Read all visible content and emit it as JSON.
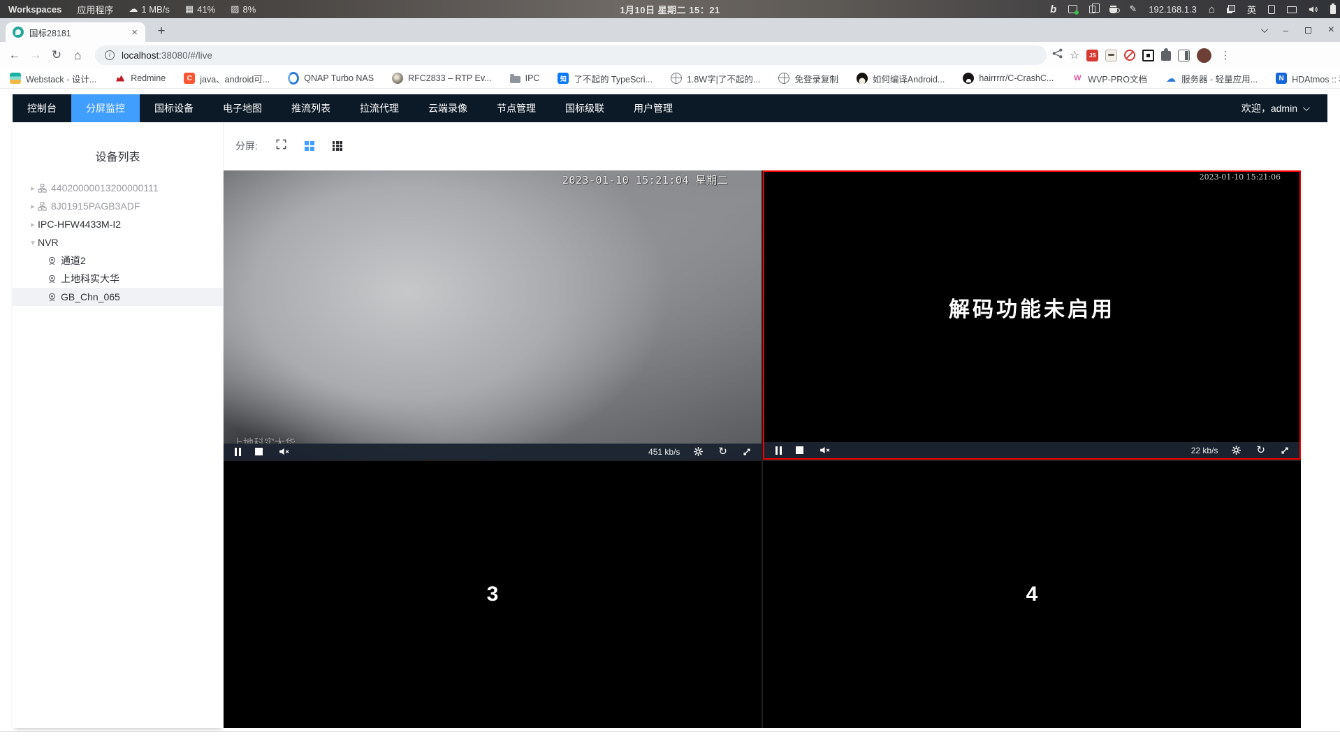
{
  "colors": {
    "accent_blue": "#409eff",
    "nav_bg": "#0c1a27",
    "selected_border_red": "#f30000",
    "favicon_teal": "#23a69a"
  },
  "system_bar": {
    "workspaces": "Workspaces",
    "applications": "应用程序",
    "net_speed": "1 MB/s",
    "cpu_pct": "41%",
    "mem_pct": "8%",
    "clock": "1月10日 星期二 15：21",
    "ip": "192.168.1.3",
    "ime": "英"
  },
  "browser": {
    "tab_title": "国标28181",
    "address": {
      "host": "localhost",
      "rest": ":38080/#/live"
    },
    "bookmarks": [
      {
        "label": "Webstack - 设计..."
      },
      {
        "label": "Redmine"
      },
      {
        "label": "java、android可..."
      },
      {
        "label": "QNAP Turbo NAS"
      },
      {
        "label": "RFC2833 – RTP Ev..."
      },
      {
        "label": "IPC"
      },
      {
        "label": "了不起的 TypeScri..."
      },
      {
        "label": "1.8W字|了不起的..."
      },
      {
        "label": "免登录复制"
      },
      {
        "label": "如何编译Android..."
      },
      {
        "label": "hairrrrr/C-CrashC..."
      },
      {
        "label": "WVP-PRO文档"
      },
      {
        "label": "服务器 - 轻量应用..."
      },
      {
        "label": "HDAtmos :: 种子 *..."
      }
    ],
    "ext_js_label": "JS"
  },
  "glyphs": {
    "back": "←",
    "forward": "→",
    "reload": "↻",
    "home": "⌂",
    "star": "☆",
    "kebab": "⋮",
    "tab_close": "×",
    "new_tab": "+",
    "overflow": "»",
    "minimize": "–",
    "win_close": "×",
    "caret_right": "▸",
    "caret_down": "▾",
    "info": "i",
    "tray_download": "☁",
    "tray_arrow": "↓",
    "tray_cpu": "▦",
    "tray_mem": "▨",
    "tray_pen": "✎",
    "tray_bing": "b"
  },
  "nav": {
    "items": [
      "控制台",
      "分屏监控",
      "国标设备",
      "电子地图",
      "推流列表",
      "拉流代理",
      "云端录像",
      "节点管理",
      "国标级联",
      "用户管理"
    ],
    "welcome": "欢迎，admin"
  },
  "sidebar": {
    "title": "设备列表",
    "items": [
      {
        "label": "44020000013200000111"
      },
      {
        "label": "8J01915PAGB3ADF"
      },
      {
        "label": "IPC-HFW4433M-I2"
      },
      {
        "label": "NVR"
      },
      {
        "label": "通道2"
      },
      {
        "label": "上地科实大华"
      },
      {
        "label": "GB_Chn_065"
      }
    ]
  },
  "screen_toolbar": {
    "label": "分屏:"
  },
  "players": {
    "p1": {
      "osd_time": "2023-01-10 15:21:04 星期二",
      "osd_name": "上地科实大华",
      "bitrate": "451 kb/s"
    },
    "p2": {
      "osd_time": "2023-01-10 15:21:06",
      "message": "解码功能未启用",
      "bitrate": "22 kb/s"
    },
    "p3": {
      "number": "3"
    },
    "p4": {
      "number": "4"
    }
  }
}
